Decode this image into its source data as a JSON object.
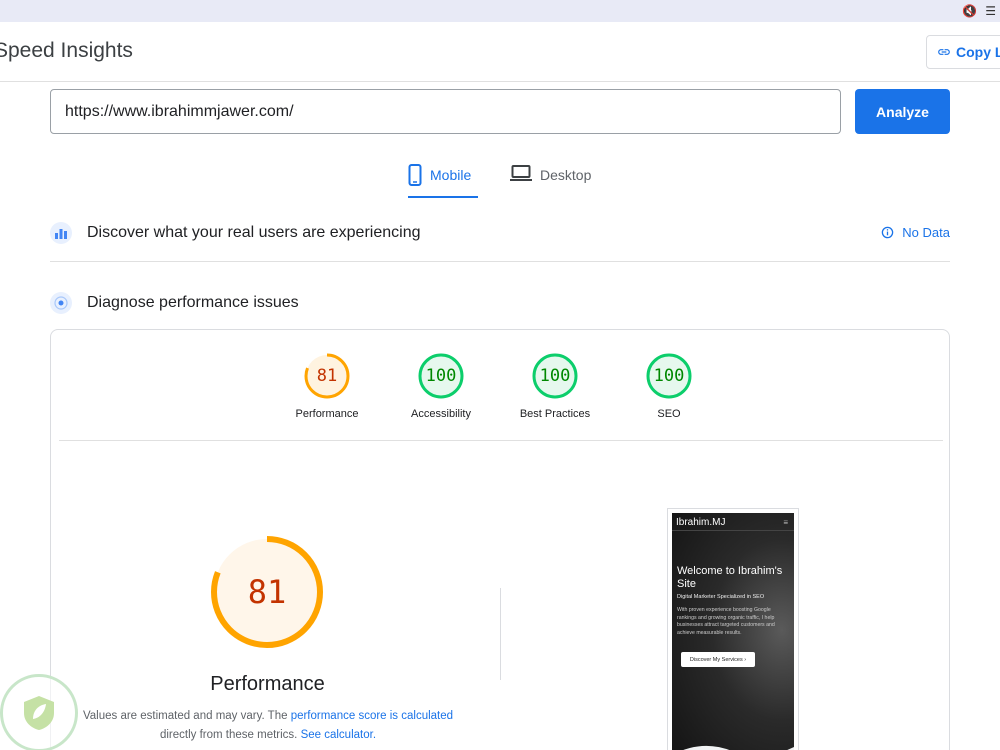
{
  "app": {
    "title": "Speed Insights",
    "copy_label": "Copy L"
  },
  "search": {
    "url": "https://www.ibrahimmjawer.com/",
    "analyze_label": "Analyze"
  },
  "tabs": [
    {
      "label": "Mobile",
      "active": true,
      "icon": "smartphone-icon"
    },
    {
      "label": "Desktop",
      "active": false,
      "icon": "laptop-icon"
    }
  ],
  "field_data": {
    "title": "Discover what your real users are experiencing",
    "status": "No Data"
  },
  "diagnose": {
    "title": "Diagnose performance issues"
  },
  "scores": [
    {
      "value": 0.81,
      "display": "81",
      "label": "Performance",
      "color": "#ffa400"
    },
    {
      "value": 1.0,
      "display": "100",
      "label": "Accessibility",
      "color": "#0cce6b"
    },
    {
      "value": 1.0,
      "display": "100",
      "label": "Best Practices",
      "color": "#0cce6b"
    },
    {
      "value": 1.0,
      "display": "100",
      "label": "SEO",
      "color": "#0cce6b"
    }
  ],
  "main_score": {
    "value": 0.81,
    "display": "81",
    "label": "Performance",
    "color": "#ffa400"
  },
  "disclaimer": {
    "prefix": "Values are estimated and may vary. The ",
    "link1": "performance score is calculated",
    "middle": "directly from these metrics. ",
    "link2": "See calculator."
  },
  "screenshot": {
    "brand": "Ibrahim.MJ",
    "menu": "≡",
    "heading": "Welcome to Ibrahim's Site",
    "subheading": "Digital Marketer Specialized in SEO",
    "body": "With proven experience boosting Google rankings and growing organic traffic, I help businesses attract targeted customers and achieve measurable results.",
    "cta": "Discover My Services ›"
  },
  "colors": {
    "accent": "#1a73e8",
    "pass": "#0cce6b",
    "average": "#ffa400"
  }
}
